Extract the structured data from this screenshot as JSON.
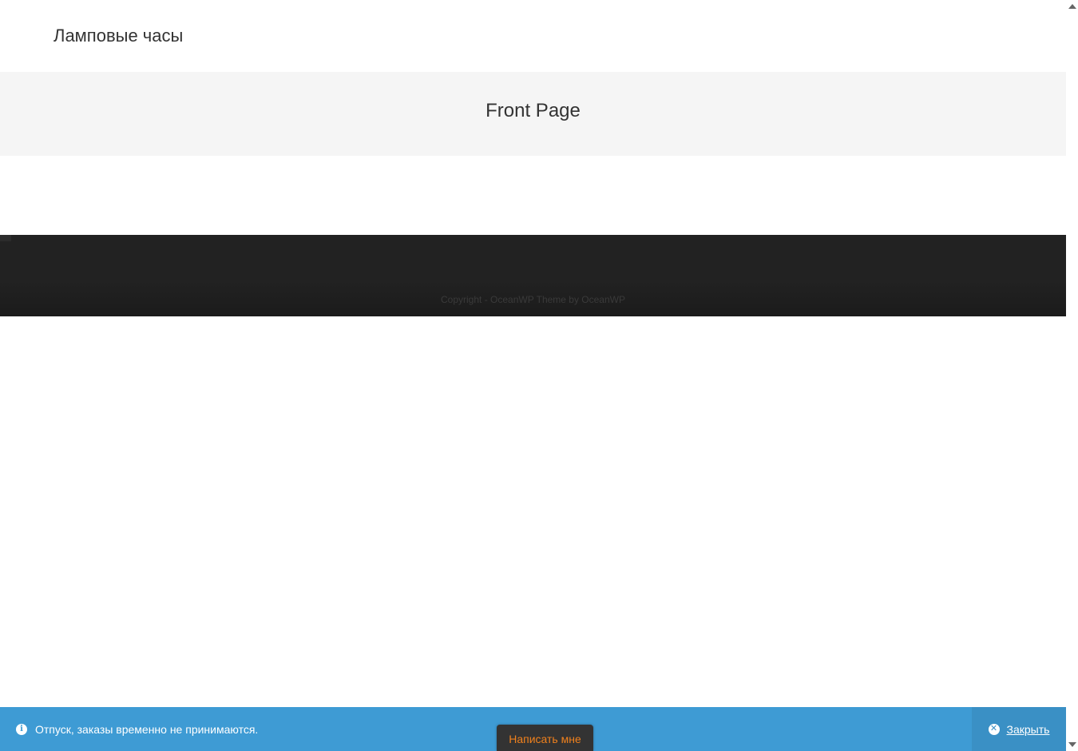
{
  "site": {
    "title": "Ламповые часы"
  },
  "page_header": {
    "title": "Front Page"
  },
  "footer": {
    "copyright": "Copyright - OceanWP Theme by OceanWP"
  },
  "notice": {
    "icon": "info-icon",
    "text": "Отпуск, заказы временно не принимаются.",
    "dismiss_icon": "close-circle-icon",
    "dismiss_label": "Закрыть",
    "background_color": "#3e9bd4"
  },
  "chat": {
    "label": "Написать мне",
    "text_color": "#f0811d"
  }
}
